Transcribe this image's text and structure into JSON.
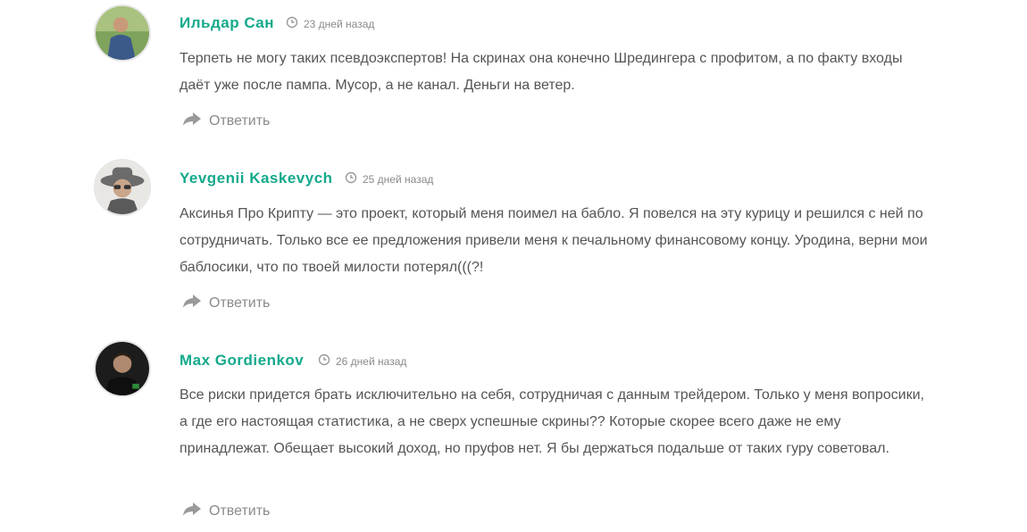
{
  "comments": [
    {
      "author": "Ильдар Сан",
      "date": "23 дней назад",
      "text": "Терпеть не могу таких псевдоэкспертов! На скринах она конечно Шредингера с профитом, а по факту входы даёт уже после пампа. Мусор, а не канал. Деньги на ветер.",
      "reply_label": "Ответить"
    },
    {
      "author": "Yevgenii Kaskevych",
      "date": "25 дней назад",
      "text": "Аксинья Про Крипту — это проект, который меня поимел на бабло. Я повелся на эту курицу и решился с ней по сотрудничать. Только все ее предложения привели меня к печальному финансовому концу. Уродина, верни мои баблосики, что по твоей милости потерял(((?!",
      "reply_label": "Ответить"
    },
    {
      "author": "Max Gordienkov",
      "date": "26 дней назад",
      "text": "Все риски придется брать исключительно на себя, сотрудничая с данным трейдером. Только у меня вопросики, а где его настоящая статистика, а не сверх успешные скрины?? Которые скорее всего даже не ему принадлежат. Обещает высокий доход, но пруфов нет. Я бы держаться подальше от таких гуру советовал.",
      "reply_label": "Ответить"
    }
  ],
  "colors": {
    "author": "#13a98b",
    "text": "#555555",
    "meta": "#8a8a8a"
  },
  "icons": {
    "date": "clock-icon",
    "reply": "reply-arrow-icon"
  }
}
